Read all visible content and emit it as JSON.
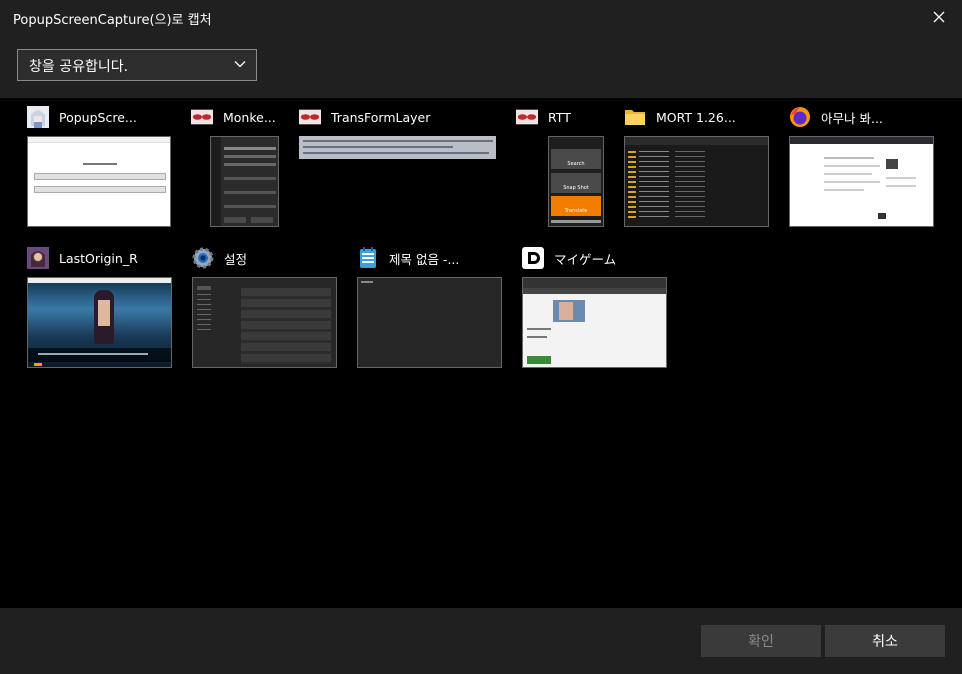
{
  "window": {
    "title": "PopupScreenCapture(으)로 캡처"
  },
  "share_dropdown": {
    "selected": "창을 공유합니다."
  },
  "windows": [
    {
      "title": "PopupScre...",
      "icon": "anime-avatar-icon"
    },
    {
      "title": "Monke...",
      "icon": "red-eyes-icon"
    },
    {
      "title": "TransFormLayer",
      "icon": "red-eyes-icon"
    },
    {
      "title": "RTT",
      "icon": "red-eyes-icon"
    },
    {
      "title": "MORT 1.26...",
      "icon": "folder-icon"
    },
    {
      "title": "아무나 봐...",
      "icon": "firefox-icon"
    },
    {
      "title": "LastOrigin_R",
      "icon": "game-avatar-icon"
    },
    {
      "title": "설정",
      "icon": "gear-icon"
    },
    {
      "title": "제목 없음 -...",
      "icon": "notepad-icon"
    },
    {
      "title": "マイゲーム",
      "icon": "d-logo-icon"
    }
  ],
  "rtt_panel": {
    "search": "Search",
    "snap": "Snap Shot",
    "translate": "Translate"
  },
  "footer": {
    "ok_label": "확인",
    "cancel_label": "취소"
  }
}
